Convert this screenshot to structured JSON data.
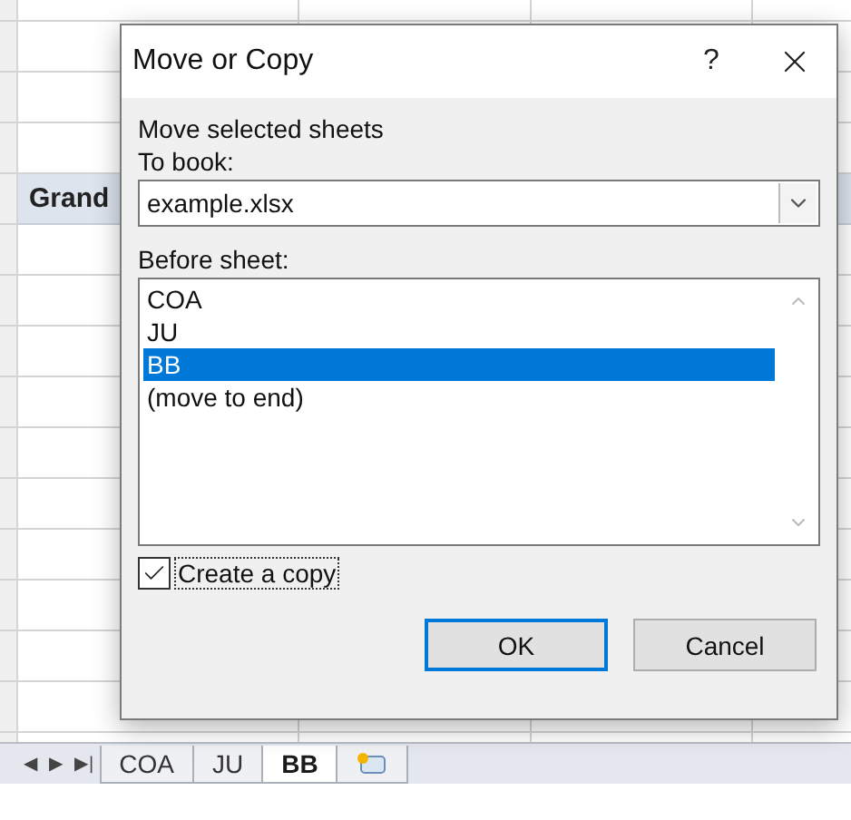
{
  "sheet": {
    "grand_total_label": "Grand"
  },
  "sheet_nav": [
    "◀",
    "▶",
    "▶|"
  ],
  "sheet_tabs": [
    {
      "label": "COA",
      "selected": false
    },
    {
      "label": "JU",
      "selected": false
    },
    {
      "label": "BB",
      "selected": true
    }
  ],
  "dialog": {
    "title": "Move or Copy",
    "help": "?",
    "heading": "Move selected sheets",
    "to_book_label": "To book:",
    "to_book_value": "example.xlsx",
    "before_sheet_label": "Before sheet:",
    "sheets": [
      {
        "label": "COA",
        "selected": false
      },
      {
        "label": "JU",
        "selected": false
      },
      {
        "label": "BB",
        "selected": true
      },
      {
        "label": "(move to end)",
        "selected": false
      }
    ],
    "create_copy": {
      "label": "Create a copy",
      "checked": true
    },
    "buttons": [
      {
        "label": "OK",
        "default": true
      },
      {
        "label": "Cancel",
        "default": false
      }
    ]
  }
}
